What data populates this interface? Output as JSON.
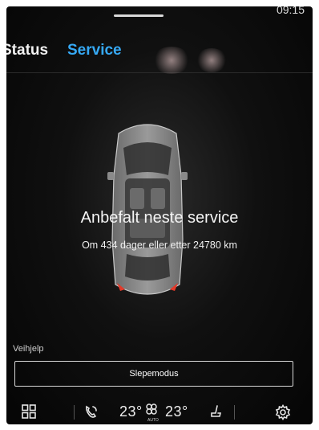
{
  "statusbar": {
    "time": "09:15"
  },
  "tabs": [
    {
      "label": "Status"
    },
    {
      "label": "Service"
    }
  ],
  "service": {
    "headline": "Anbefalt neste service",
    "detail": "Om 434 dager eller etter 24780 km"
  },
  "roadside": {
    "section_label": "Veihjelp",
    "tow_mode_button": "Slepemodus"
  },
  "climate": {
    "left_temp": "23°",
    "right_temp": "23°",
    "fan_mode": "AUTO"
  },
  "colors": {
    "accent": "#36a9f5",
    "background": "#0a0a0a",
    "text": "#ffffff"
  },
  "icons": [
    "apps-grid-icon",
    "phone-icon",
    "fan-icon",
    "seat-heat-icon",
    "gear-icon"
  ]
}
